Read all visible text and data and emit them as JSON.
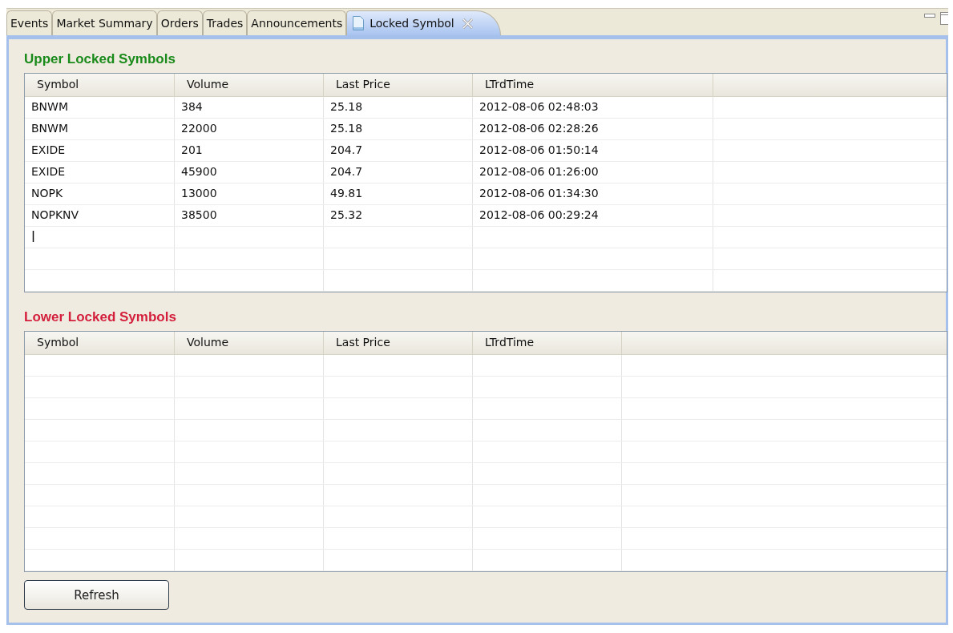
{
  "tabs": [
    {
      "label": "Events",
      "selected": false,
      "kind": "view"
    },
    {
      "label": "Market Summary",
      "selected": false,
      "kind": "view"
    },
    {
      "label": "Orders",
      "selected": false,
      "kind": "view"
    },
    {
      "label": "Trades",
      "selected": false,
      "kind": "view"
    },
    {
      "label": "Announcements",
      "selected": false,
      "kind": "view"
    },
    {
      "label": "Locked Symbol",
      "selected": true,
      "kind": "document"
    }
  ],
  "sections": [
    {
      "title": "Upper Locked Symbols",
      "color": "#1a8a1a",
      "table": {
        "columns": [
          "Symbol",
          "Volume",
          "Last Price",
          "LTrdTime"
        ],
        "rows": [
          [
            "BNWM",
            "384",
            "25.18",
            "2012-08-06 02:48:03"
          ],
          [
            "BNWM",
            "22000",
            "25.18",
            "2012-08-06 02:28:26"
          ],
          [
            "EXIDE",
            "201",
            "204.7",
            "2012-08-06 01:50:14"
          ],
          [
            "EXIDE",
            "45900",
            "204.7",
            "2012-08-06 01:26:00"
          ],
          [
            "NOPK",
            "13000",
            "49.81",
            "2012-08-06 01:34:30"
          ],
          [
            "NOPKNV",
            "38500",
            "25.32",
            "2012-08-06 00:29:24"
          ]
        ]
      }
    },
    {
      "title": "Lower Locked Symbols",
      "color": "#d41f3c",
      "table": {
        "columns": [
          "Symbol",
          "Volume",
          "Last Price",
          "LTrdTime"
        ]
      }
    }
  ],
  "buttons": [
    "Refresh"
  ]
}
